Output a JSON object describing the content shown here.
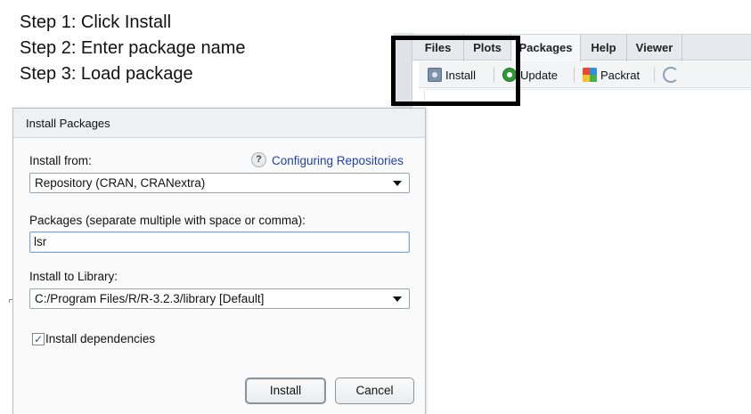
{
  "instructions": {
    "step1": "Step 1: Click Install",
    "step2": "Step 2: Enter package name",
    "step3": "Step 3: Load package"
  },
  "rstudio_pane": {
    "tabs": [
      "Files",
      "Plots",
      "Packages",
      "Help",
      "Viewer"
    ],
    "active_tab": "Packages",
    "toolbar": {
      "install_label": "Install",
      "update_label": "Update",
      "packrat_label": "Packrat"
    },
    "highlight_color": "#000000"
  },
  "dialog": {
    "title": "Install Packages",
    "install_from_label": "Install from:",
    "help_icon_glyph": "?",
    "configuring_link": "Configuring Repositories",
    "install_from_value": "Repository (CRAN, CRANextra)",
    "packages_label": "Packages (separate multiple with space or comma):",
    "packages_value": "lsr",
    "library_label": "Install to Library:",
    "library_value": "C:/Program Files/R/R-3.2.3/library [Default]",
    "dependencies_label": "Install dependencies",
    "dependencies_checked": true,
    "checkmark_glyph": "✓",
    "install_button": "Install",
    "cancel_button": "Cancel",
    "link_color": "#1d3fae"
  }
}
